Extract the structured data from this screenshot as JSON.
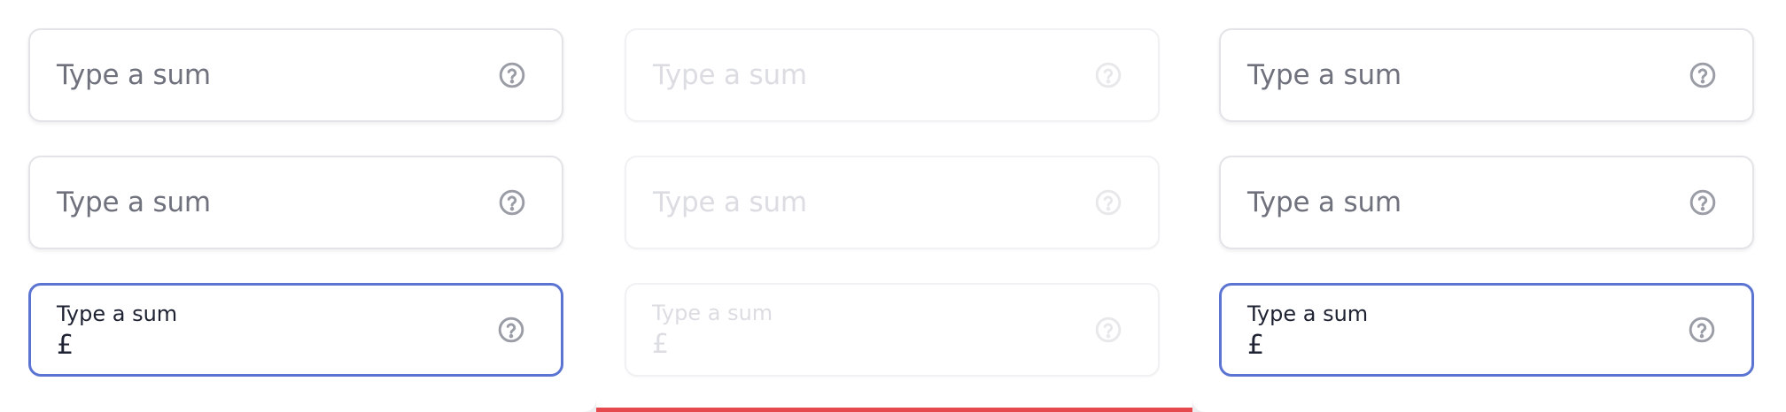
{
  "columns": [
    {
      "state": "default",
      "fields": [
        {
          "variant": "placeholder",
          "placeholder": "Type a sum",
          "help_icon": "question-circle-icon"
        },
        {
          "variant": "placeholder",
          "placeholder": "Type a sum",
          "help_icon": "question-circle-icon"
        },
        {
          "variant": "focused",
          "label": "Type a sum",
          "value": "£",
          "help_icon": "question-circle-icon"
        }
      ]
    },
    {
      "state": "disabled",
      "fields": [
        {
          "variant": "placeholder",
          "placeholder": "Type a sum",
          "help_icon": "question-circle-icon"
        },
        {
          "variant": "placeholder",
          "placeholder": "Type a sum",
          "help_icon": "question-circle-icon"
        },
        {
          "variant": "filled",
          "label": "Type a sum",
          "value": "£",
          "help_icon": "question-circle-icon"
        }
      ]
    },
    {
      "state": "default",
      "fields": [
        {
          "variant": "placeholder",
          "placeholder": "Type a sum",
          "help_icon": "question-circle-icon"
        },
        {
          "variant": "placeholder",
          "placeholder": "Type a sum",
          "help_icon": "question-circle-icon"
        },
        {
          "variant": "focused",
          "label": "Type a sum",
          "value": "£",
          "help_icon": "question-circle-icon"
        }
      ]
    }
  ],
  "colors": {
    "focus_border": "#5b74d2",
    "border": "#e3e3e8",
    "placeholder_text": "#6f717d",
    "text": "#1e2233",
    "icon": "#9a9ca6",
    "error_bar": "#e5484d"
  }
}
